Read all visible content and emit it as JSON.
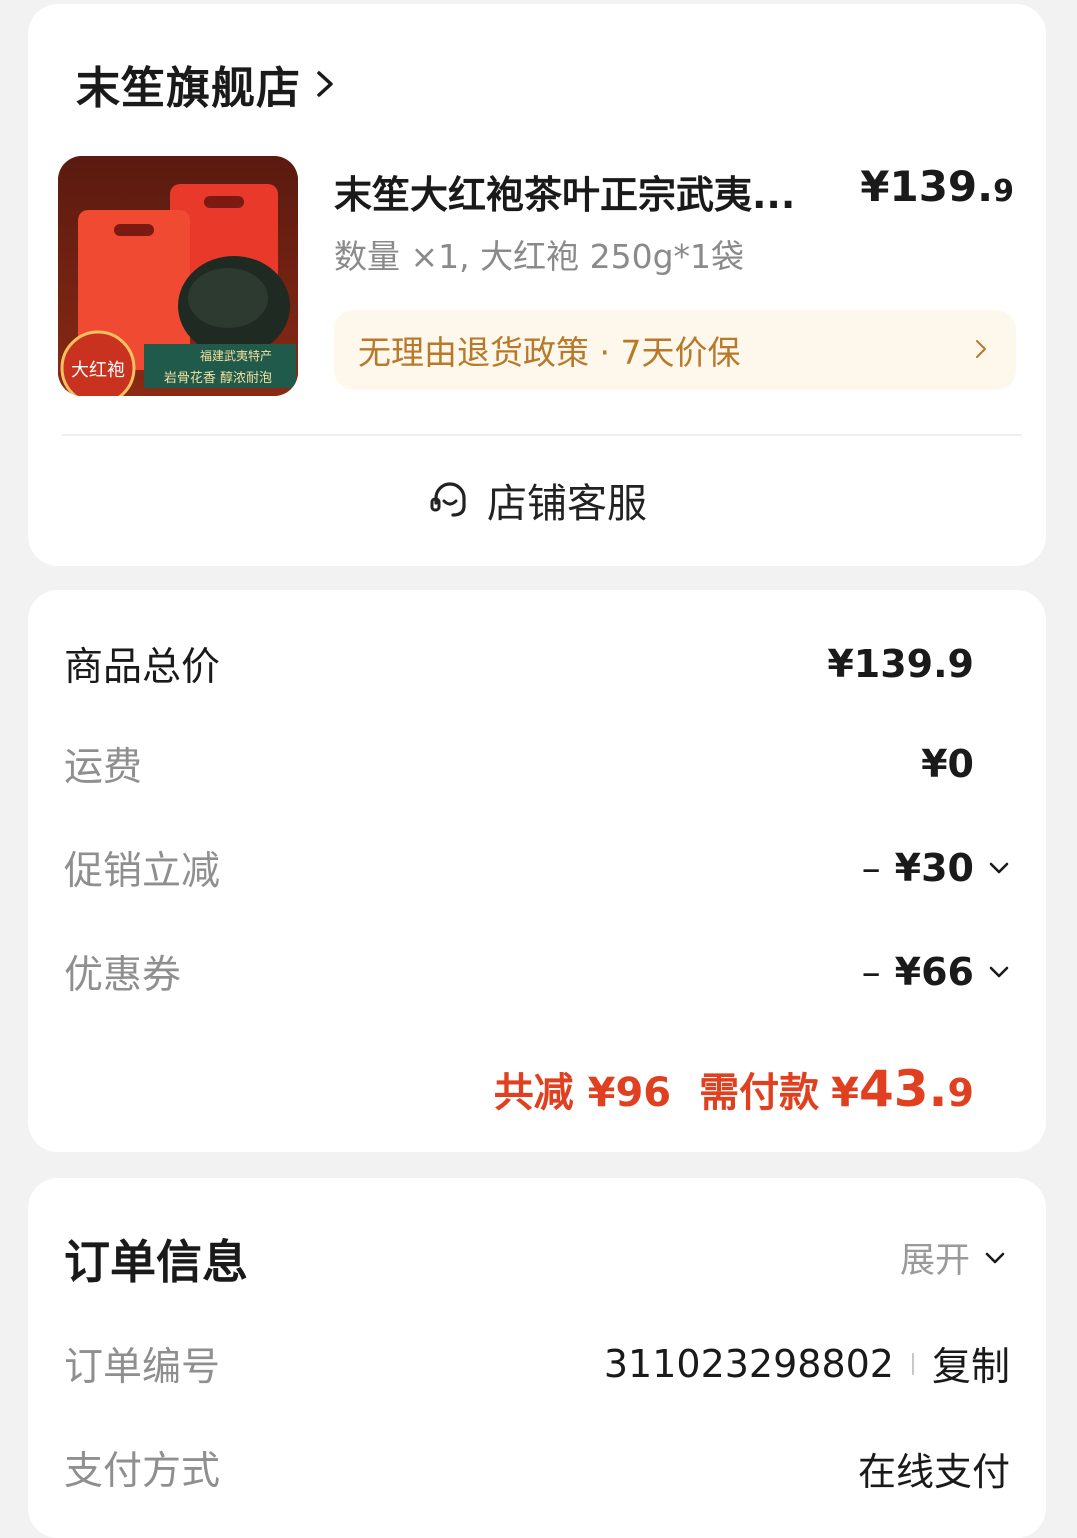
{
  "store": {
    "name": "末笙旗舰店",
    "product": {
      "title": "末笙大红袍茶叶正宗武夷...",
      "price_main": "¥139.",
      "price_cents": "9",
      "spec": "数量 ×1, 大红袍 250g*1袋",
      "image_texts": [
        "大红袍",
        "福建武夷特产",
        "岩骨花香 醇浓耐泡"
      ]
    },
    "policy": "无理由退货政策 · 7天价保",
    "service_label": "店铺客服"
  },
  "prices": {
    "rows": [
      {
        "label": "商品总价",
        "value": "¥139.9"
      },
      {
        "label": "运费",
        "value": "¥0"
      },
      {
        "label": "促销立减",
        "minus": "–",
        "value": "¥30"
      },
      {
        "label": "优惠券",
        "minus": "–",
        "value": "¥66"
      }
    ],
    "summary": {
      "reduce_label": "共减",
      "reduce_value": "¥96",
      "pay_label": "需付款",
      "pay_symbol": "¥",
      "pay_main": "43.",
      "pay_cents": "9"
    }
  },
  "order": {
    "title": "订单信息",
    "expand_label": "展开",
    "rows": [
      {
        "label": "订单编号",
        "value": "311023298802",
        "action": "复制"
      },
      {
        "label": "支付方式",
        "value": "在线支付"
      }
    ]
  },
  "colors": {
    "accent_red": "#e0401f",
    "policy_text": "#b8792a",
    "policy_bg": "#fdf7ec",
    "page_bg": "#f2f2f2"
  },
  "icons": {
    "store_chevron": "chevron-right-icon",
    "policy_chevron": "chevron-right-icon",
    "service": "headset-icon",
    "expand": "chevron-down-icon"
  }
}
